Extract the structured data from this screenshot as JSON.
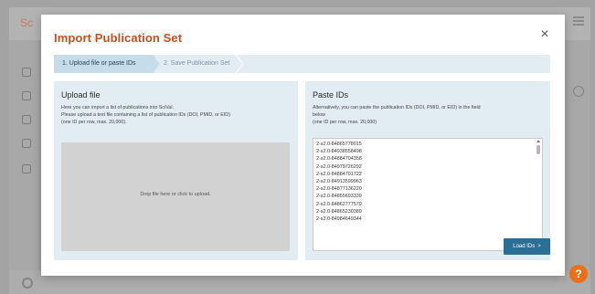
{
  "background": {
    "logo_text": "Sc",
    "help_icon": "?"
  },
  "modal": {
    "title": "Import Publication Set",
    "close_icon": "×",
    "steps": [
      {
        "label": "1. Upload file or paste IDs"
      },
      {
        "label": "2. Save Publication Set"
      }
    ],
    "upload": {
      "heading": "Upload file",
      "description_lines": [
        "Here you can import a list of publications into SciVal.",
        "Please upload a text file containing a list of publication IDs (DOI, PMID, or EID)",
        "(one ID per row, max. 20,000)."
      ],
      "dropzone_label": "Drop file here or click to upload."
    },
    "paste": {
      "heading": "Paste IDs",
      "description_lines": [
        "Alternatively, you can paste the publication IDs (DOI, PMID, or EID) in the field",
        "below",
        "(one ID per row, max. 20,000)"
      ],
      "ids": [
        "2-s2.0-84865778015",
        "2-s2.0-84938558498",
        "2-s2.0-84884704358",
        "2-s2.0-84979726292",
        "2-s2.0-84884701722",
        "2-s2.0-84913599963",
        "2-s2.0-84877136220",
        "2-s2.0-84855693339",
        "2-s2.0-84862777579",
        "2-s2.0-84865230389",
        "2-s2.0-84984649344"
      ]
    },
    "load_button": {
      "label": "Load IDs",
      "icon": ">"
    }
  },
  "colors": {
    "title": "#c2501f",
    "panel_bg": "#e1edf3",
    "primary_button": "#2c6f96",
    "help_fab": "#e9711c"
  }
}
